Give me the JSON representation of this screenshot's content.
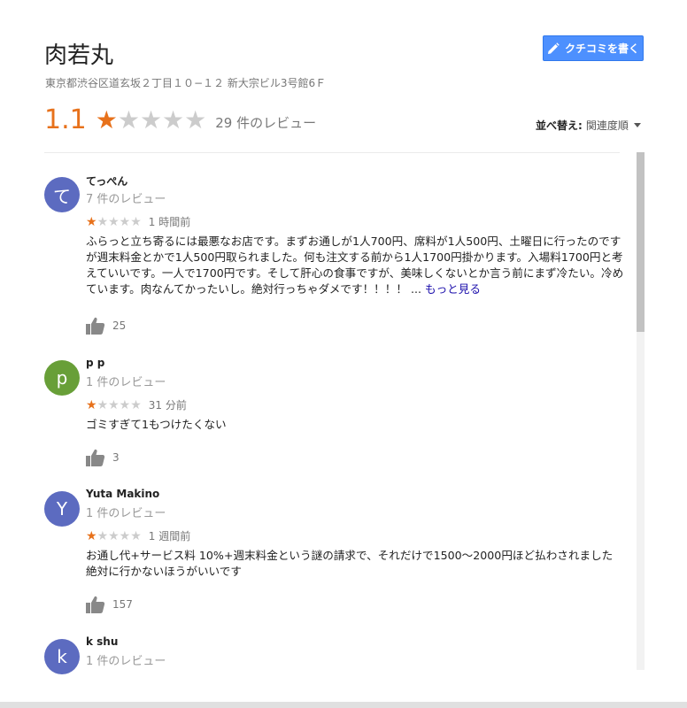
{
  "place": {
    "name": "肉若丸",
    "address": "東京都渋谷区道玄坂２丁目１０−１２ 新大宗ビル3号館6Ｆ"
  },
  "write_review_label": "クチコミを書く",
  "rating": {
    "value": "1.1",
    "stars": 1,
    "max": 5,
    "count_label": "29 件のレビュー"
  },
  "sort": {
    "label": "並べ替え:",
    "value": "関連度順"
  },
  "colors": {
    "accent": "#e7711b",
    "button": "#4d90fe",
    "link": "#1a0dab"
  },
  "reviews": [
    {
      "initial": "て",
      "avatar_color": "#5c6bc0",
      "name": "てっぺん",
      "count": "7 件のレビュー",
      "stars": 1,
      "time": "1 時間前",
      "text": "ふらっと立ち寄るには最悪なお店です。まずお通しが1人700円、席料が1人500円、土曜日に行ったのですが週末料金とかで1人500円取られました。何も注文する前から1人1700円掛かります。入場料1700円と考えていいです。一人で1700円です。そして肝心の食事ですが、美味しくないとか言う前にまず冷たい。冷めています。肉なんてかったいし。絶対行っちゃダメです！！！！ ...",
      "more": "もっと見る",
      "likes": "25"
    },
    {
      "initial": "p",
      "avatar_color": "#689f38",
      "name": "p p",
      "count": "1 件のレビュー",
      "stars": 1,
      "time": "31 分前",
      "text": "ゴミすぎて1もつけたくない",
      "likes": "3"
    },
    {
      "initial": "Y",
      "avatar_color": "#5c6bc0",
      "name": "Yuta Makino",
      "count": "1 件のレビュー",
      "stars": 1,
      "time": "1 週間前",
      "text": "お通し代+サービス料 10%+週末料金という謎の請求で、それだけで1500～2000円ほど払わされました\n絶対に行かないほうがいいです",
      "likes": "157"
    },
    {
      "initial": "k",
      "avatar_color": "#5c6bc0",
      "name": "k shu",
      "count": "1 件のレビュー"
    }
  ]
}
